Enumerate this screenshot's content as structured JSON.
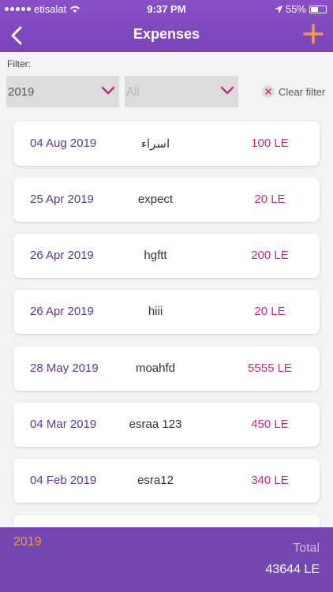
{
  "status": {
    "carrier": "etisalat",
    "time": "9:37 PM",
    "battery": "55%"
  },
  "header": {
    "title": "Expenses"
  },
  "filter": {
    "label": "Filter:",
    "year_value": "2019",
    "category_placeholder": "All",
    "clear_label": "Clear filter"
  },
  "expenses": [
    {
      "date": "04 Aug 2019",
      "name": "اسراء",
      "amount": "100 LE"
    },
    {
      "date": "25 Apr 2019",
      "name": "expect",
      "amount": "20 LE"
    },
    {
      "date": "26 Apr 2019",
      "name": "hgftt",
      "amount": "200 LE"
    },
    {
      "date": "26 Apr 2019",
      "name": "hiii",
      "amount": "20 LE"
    },
    {
      "date": "28 May 2019",
      "name": "moahfd",
      "amount": "5555 LE"
    },
    {
      "date": "04 Mar 2019",
      "name": "esraa 123",
      "amount": "450 LE"
    },
    {
      "date": "04 Feb 2019",
      "name": "esra12",
      "amount": "340 LE"
    }
  ],
  "footer": {
    "year": "2019",
    "total_label": "Total",
    "total_value": "43644 LE"
  },
  "colors": {
    "primary": "#7a44b8",
    "accent": "#f39a3a",
    "amount": "#d0257e"
  }
}
